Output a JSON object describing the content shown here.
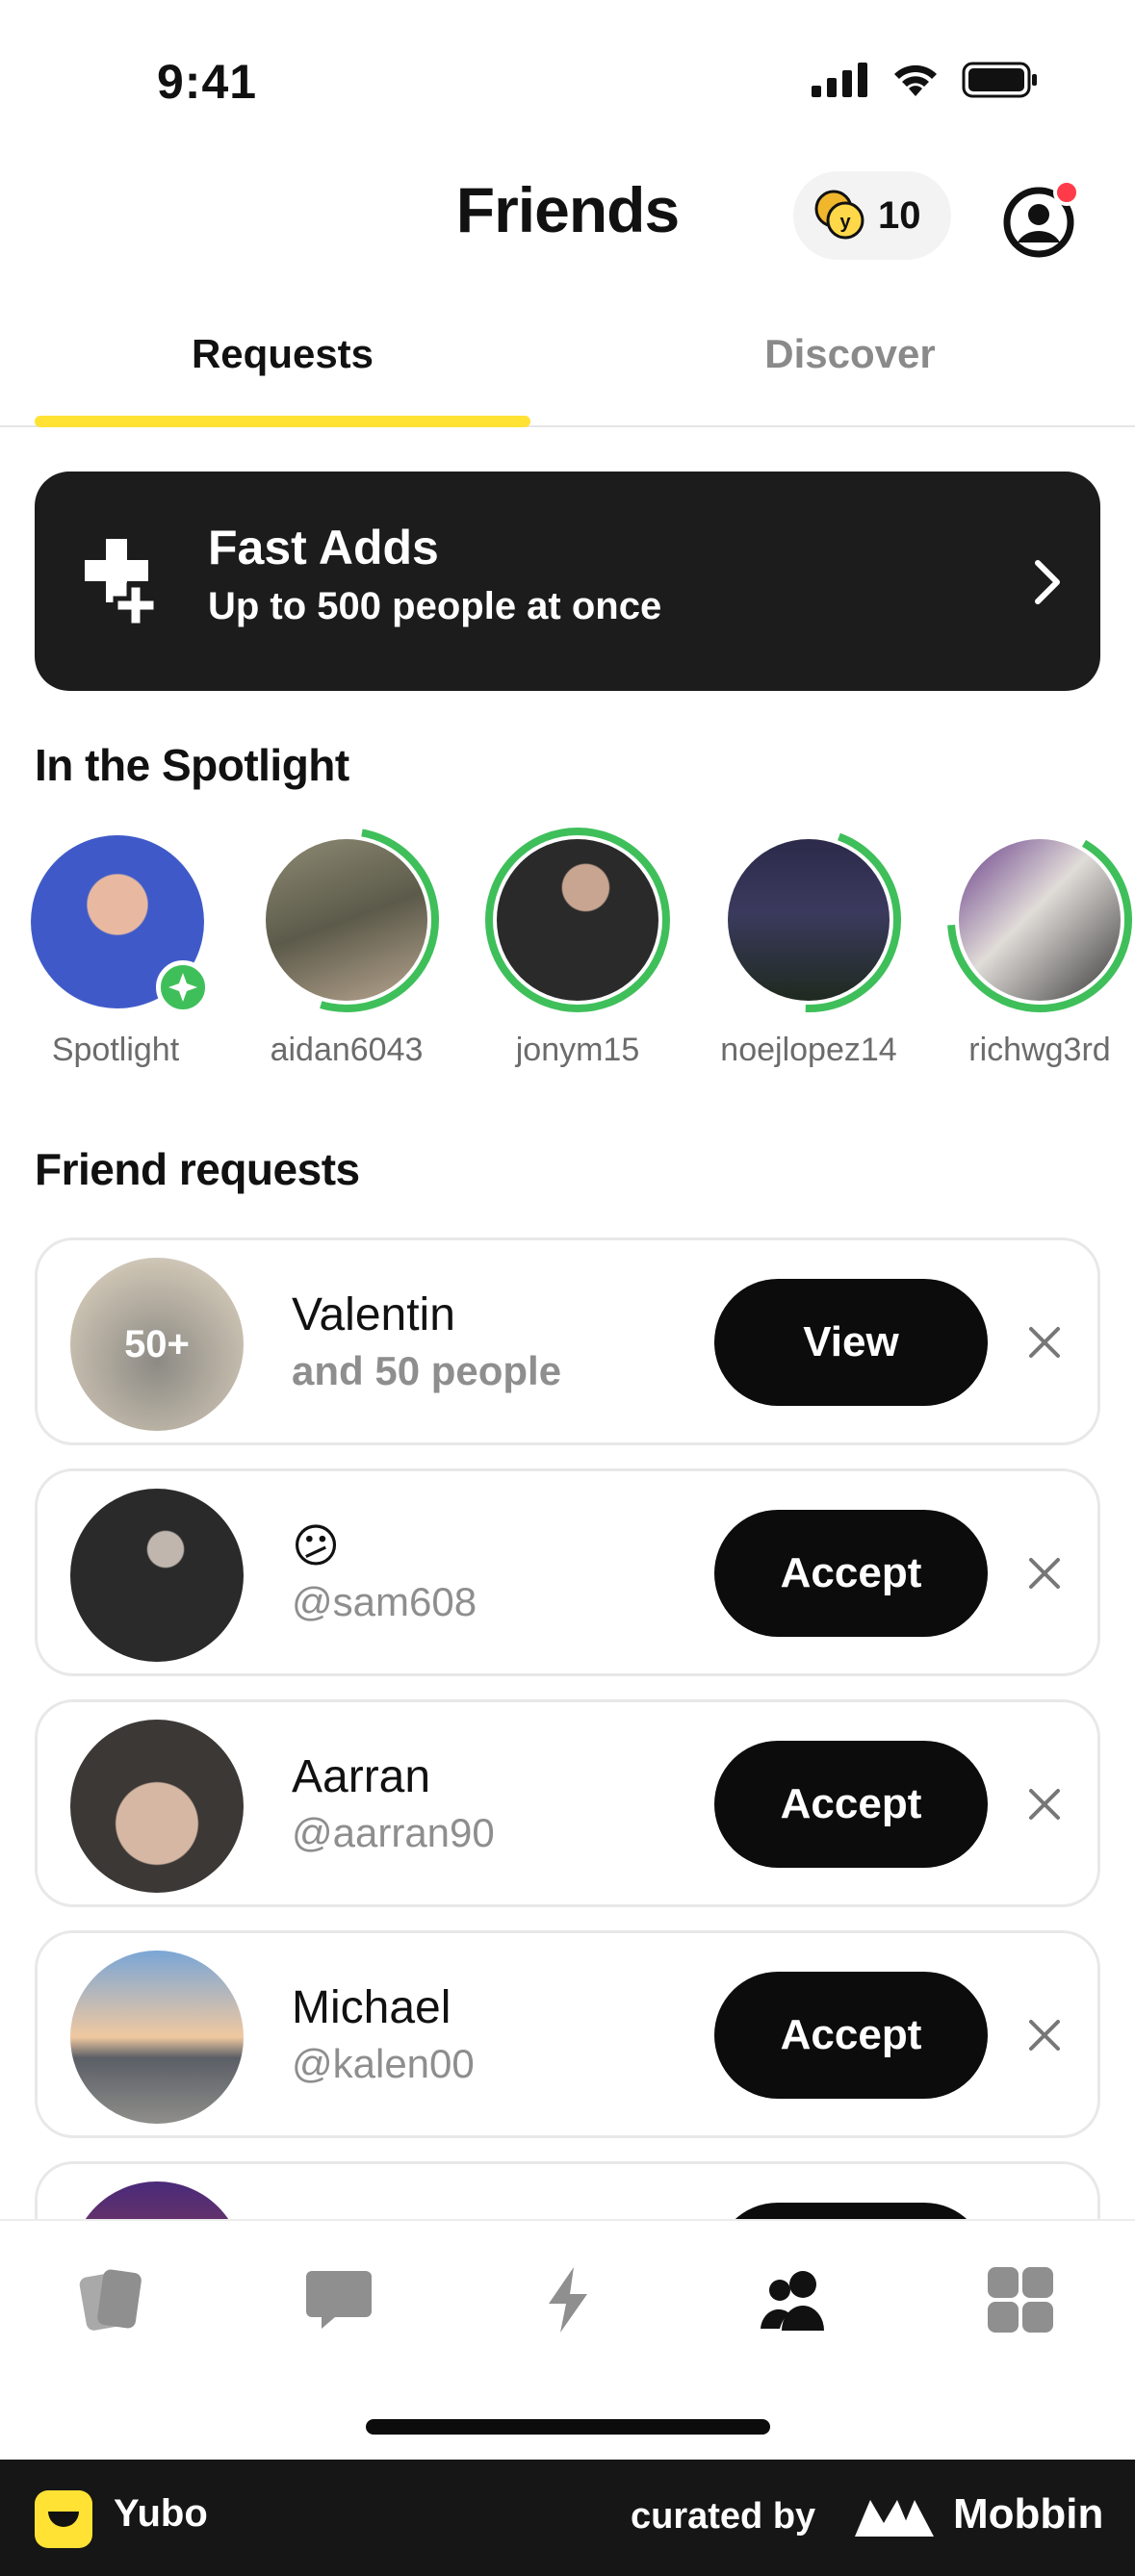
{
  "status": {
    "time": "9:41"
  },
  "header": {
    "title": "Friends",
    "coins": "10"
  },
  "tabs": [
    {
      "label": "Requests",
      "active": true
    },
    {
      "label": "Discover",
      "active": false
    }
  ],
  "fast_adds": {
    "title": "Fast Adds",
    "subtitle": "Up to 500 people at once"
  },
  "spotlight": {
    "title": "In the Spotlight",
    "items": [
      {
        "name": "Spotlight"
      },
      {
        "name": "aidan6043"
      },
      {
        "name": "jonym15"
      },
      {
        "name": "noejlopez14"
      },
      {
        "name": "richwg3rd"
      }
    ]
  },
  "friend_requests": {
    "title": "Friend requests",
    "items": [
      {
        "avatar_label": "50+",
        "name": "Valentin",
        "sub": "and 50 people",
        "action": "View"
      },
      {
        "avatar_label": "",
        "name": "😕",
        "sub": "@sam608",
        "action": "Accept"
      },
      {
        "avatar_label": "",
        "name": "Aarran",
        "sub": "@aarran90",
        "action": "Accept"
      },
      {
        "avatar_label": "",
        "name": "Michael",
        "sub": "@kalen00",
        "action": "Accept"
      }
    ]
  },
  "footer": {
    "app": "Yubo",
    "curated": "curated by",
    "brand": "Mobbin"
  },
  "colors": {
    "accent": "#ffe234",
    "ring": "#3fbf5a",
    "dark": "#0c0c0c"
  }
}
